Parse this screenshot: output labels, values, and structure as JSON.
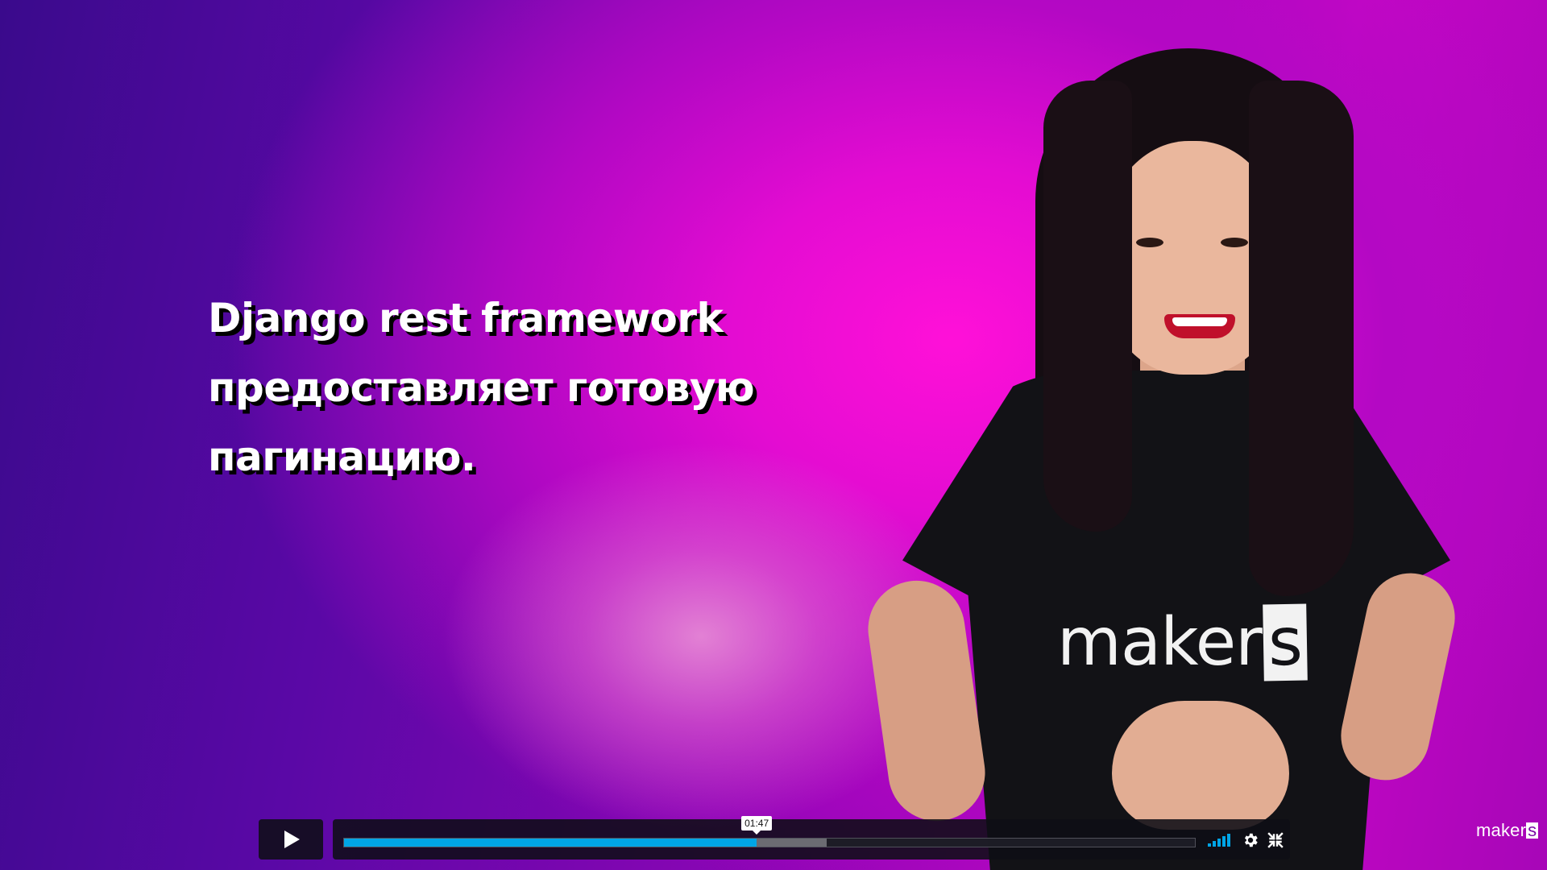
{
  "caption": {
    "lines": [
      "Django rest framework",
      "предоставляет готовую",
      "пагинацию."
    ]
  },
  "shirt_logo": {
    "text": "maker",
    "boxed": "s"
  },
  "player": {
    "hover_time": "01:47",
    "progress_played_fraction": 0.485,
    "progress_buffered_fraction": 0.567,
    "accent_color": "#00a5e6",
    "icons": [
      "play-icon",
      "volume-icon",
      "settings-icon",
      "fullscreen-icon"
    ]
  },
  "watermark": {
    "text": "maker",
    "boxed": "s"
  }
}
